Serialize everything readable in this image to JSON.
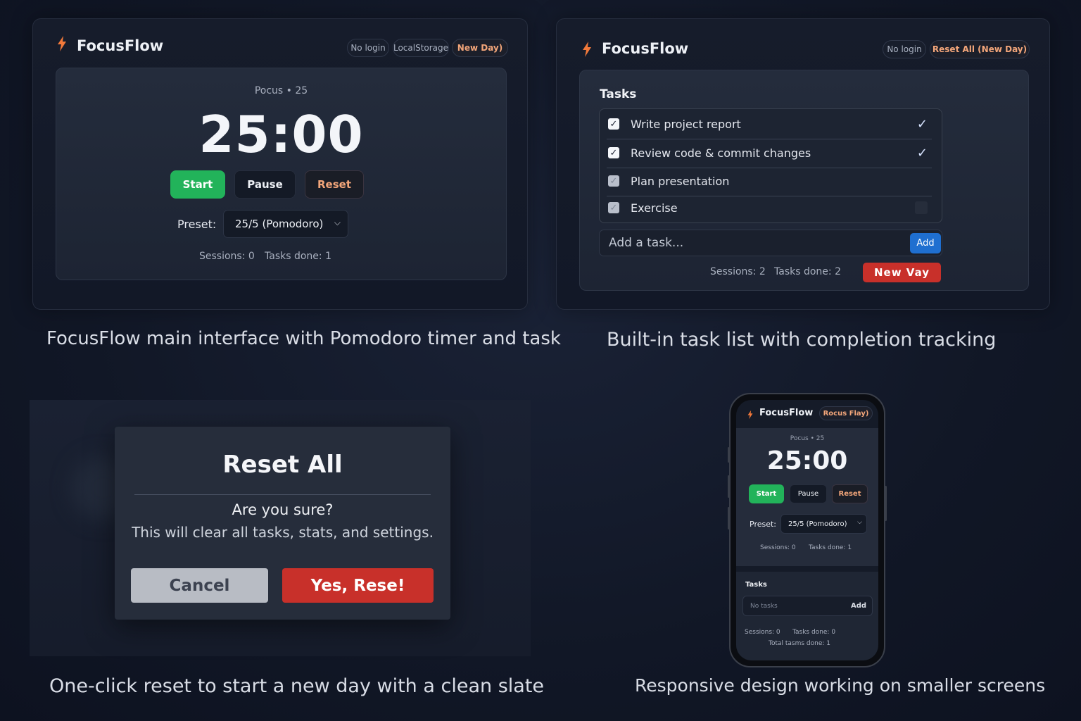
{
  "panel1": {
    "brand": "FocusFlow",
    "pills": [
      "No login",
      "LocalStorage",
      "New Day)"
    ],
    "mode": "Pocus • 25",
    "timer": "25:00",
    "buttons": {
      "start": "Start",
      "pause": "Pause",
      "reset": "Reset"
    },
    "preset_label": "Preset:",
    "preset_value": "25/5 (Pomodoro)",
    "sessions": "Sessions: 0",
    "tasks_done": "Tasks done: 1",
    "caption": "FocusFlow main interface with Pomodoro timer and task"
  },
  "panel2": {
    "brand": "FocusFlow",
    "pills": [
      "No login",
      "Reset All (New Day)"
    ],
    "tasks_title": "Tasks",
    "tasks": [
      {
        "label": "Write project report",
        "done": true
      },
      {
        "label": "Review code & commit changes",
        "done": true
      },
      {
        "label": "Plan presentation",
        "done": false
      },
      {
        "label": "Exercise",
        "done": false
      }
    ],
    "add_placeholder": "Add a task...",
    "add_button": "Add",
    "sessions": "Sessions: 2",
    "tasks_done": "Tasks done: 2",
    "new_day_button": "New Vay",
    "caption": "Built-in task list with completion tracking"
  },
  "panel3": {
    "title": "Reset All",
    "question": "Are you sure?",
    "message": "This will clear all tasks, stats, and settings.",
    "cancel": "Cancel",
    "confirm": "Yes, Rese!",
    "caption": "One-click reset to start a new day with a clean slate"
  },
  "panel4": {
    "brand": "FocusFlow",
    "pill": "Rocus Flay)",
    "mode": "Pocus • 25",
    "timer": "25:00",
    "buttons": {
      "start": "Start",
      "pause": "Pause",
      "reset": "Reset"
    },
    "preset_label": "Preset:",
    "preset_value": "25/5 (Pomodoro)",
    "sessions": "Sessions: 0",
    "tasks_done": "Tasks done: 1",
    "tasks_title": "Tasks",
    "add_placeholder": "No tasks",
    "add_button": "Add",
    "sessions2": "Sessions: 0",
    "tasks_done2": "Tasks done: 0",
    "total_done": "Total tasms done: 1",
    "caption": "Responsive design working on smaller screens"
  },
  "colors": {
    "accent": "#f2793a",
    "green": "#22b35a",
    "danger": "#c8302a",
    "blue": "#1f6fd0"
  }
}
